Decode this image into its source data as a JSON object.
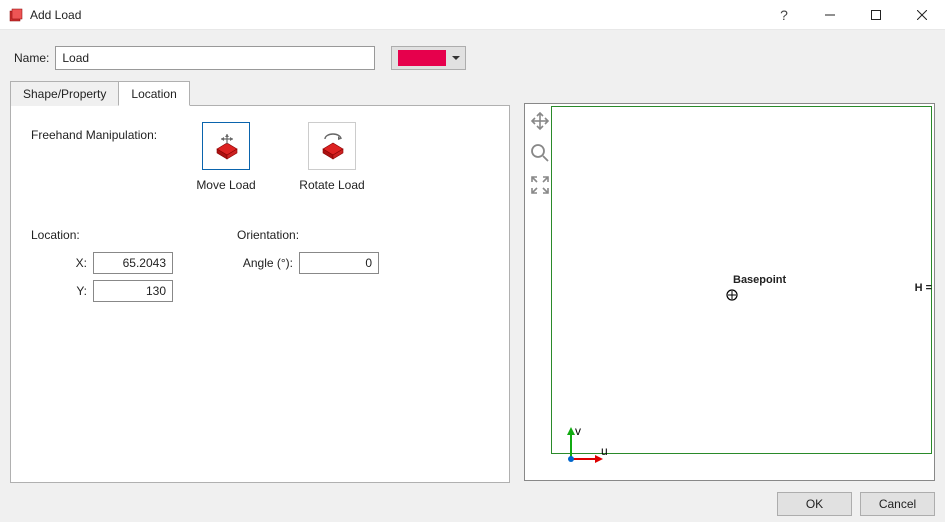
{
  "window": {
    "title": "Add Load"
  },
  "name": {
    "label": "Name:",
    "value": "Load",
    "color": "#e6004c"
  },
  "tabs": {
    "shape": "Shape/Property",
    "location": "Location",
    "active": "location"
  },
  "location_tab": {
    "freehand_label": "Freehand Manipulation:",
    "tools": {
      "move": "Move Load",
      "rotate": "Rotate Load"
    },
    "location_group": {
      "title": "Location:",
      "x_label": "X:",
      "x_value": "65.2043",
      "y_label": "Y:",
      "y_value": "130"
    },
    "orientation_group": {
      "title": "Orientation:",
      "angle_label": "Angle (°):",
      "angle_value": "0"
    }
  },
  "preview": {
    "basepoint_label": "Basepoint",
    "axis_v": "v",
    "axis_u": "u",
    "h_label": "H ="
  },
  "buttons": {
    "ok": "OK",
    "cancel": "Cancel"
  }
}
